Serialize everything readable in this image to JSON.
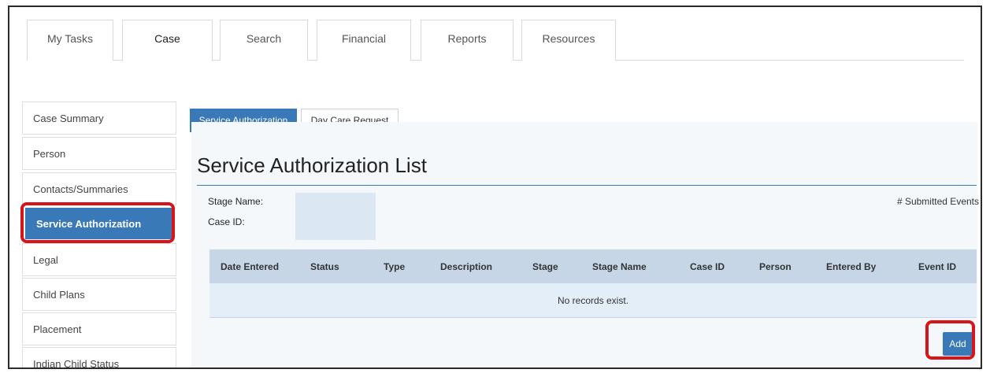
{
  "top_tabs": [
    "My Tasks",
    "Case",
    "Search",
    "Financial",
    "Reports",
    "Resources"
  ],
  "active_top_tab": "Case",
  "sidebar": {
    "items": [
      {
        "label": "Case Summary"
      },
      {
        "label": "Person"
      },
      {
        "label": "Contacts/Summaries"
      },
      {
        "label": "Service Authorization"
      },
      {
        "label": "Legal"
      },
      {
        "label": "Child Plans"
      },
      {
        "label": "Placement"
      },
      {
        "label": "Indian Child Status"
      }
    ],
    "active": "Service Authorization"
  },
  "sub_tabs": [
    "Service Authorization",
    "Day Care Request"
  ],
  "active_sub_tab": "Service Authorization",
  "page_title": "Service Authorization List",
  "stage_name_label": "Stage Name:",
  "case_id_label": "Case ID:",
  "submitted_events": "# Submitted Events",
  "table": {
    "columns": [
      "Date Entered",
      "Status",
      "Type",
      "Description",
      "Stage",
      "Stage Name",
      "Case ID",
      "Person",
      "Entered By",
      "Event ID"
    ],
    "empty_message": "No records exist."
  },
  "add_label": "Add",
  "colors": {
    "accent": "#3a79b8",
    "highlight": "#d7141a",
    "header_bg": "#c6d6e6"
  }
}
